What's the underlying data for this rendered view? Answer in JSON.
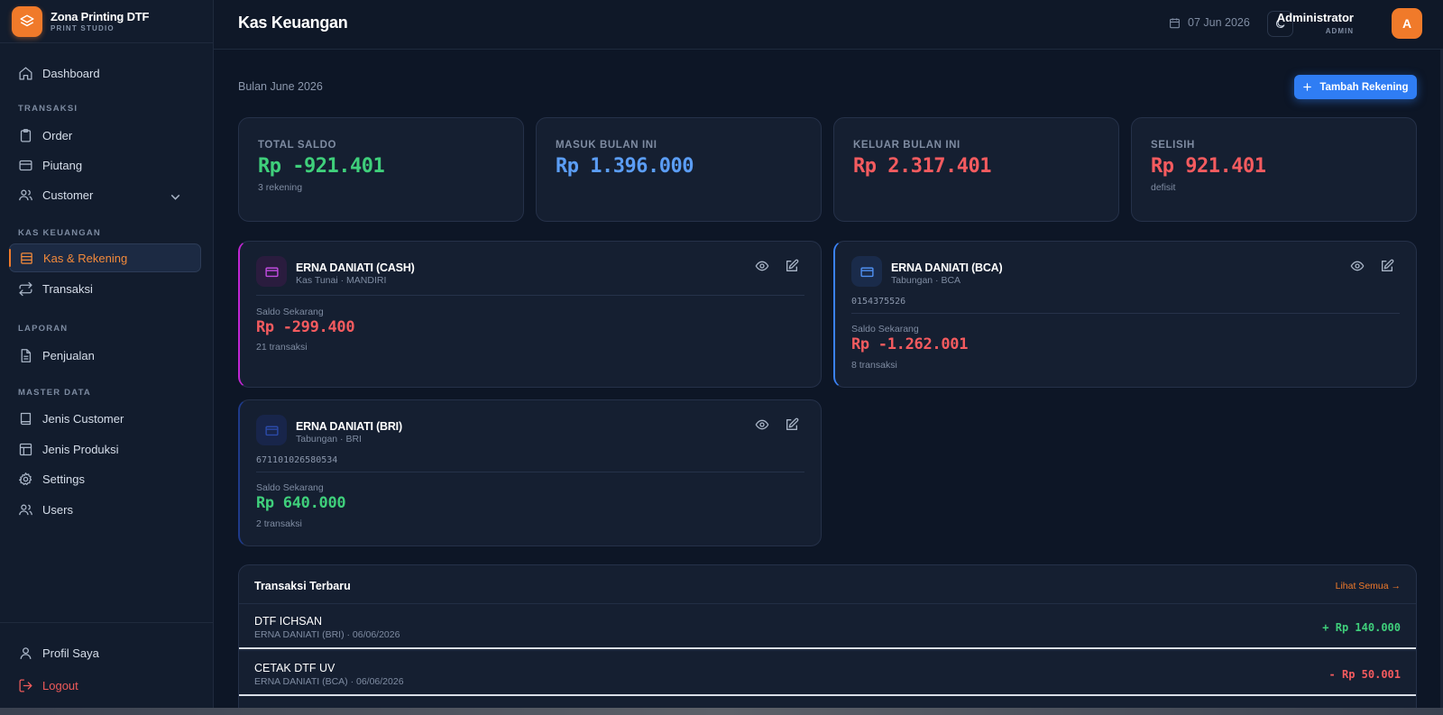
{
  "brand": {
    "name": "Zona Printing DTF",
    "subtitle": "PRINT STUDIO"
  },
  "sidebar": {
    "dashboard": "Dashboard",
    "sections": {
      "transaksi": "TRANSAKSI",
      "kas": "KAS KEUANGAN",
      "laporan": "LAPORAN",
      "master": "MASTER DATA"
    },
    "items": {
      "order": "Order",
      "piutang": "Piutang",
      "customer": "Customer",
      "kas_rekening": "Kas & Rekening",
      "transaksi": "Transaksi",
      "penjualan": "Penjualan",
      "jenis_customer": "Jenis Customer",
      "jenis_produksi": "Jenis Produksi",
      "settings": "Settings",
      "users": "Users"
    },
    "bottom": {
      "profil": "Profil Saya",
      "logout": "Logout"
    }
  },
  "header": {
    "title": "Kas Keuangan",
    "date": "07 Jun 2026",
    "user_name": "Administrator",
    "user_role": "ADMIN",
    "avatar_initial": "A"
  },
  "main": {
    "month_label": "Bulan June 2026",
    "add_button": "Tambah Rekening",
    "stats": [
      {
        "label": "TOTAL SALDO",
        "value": "Rp -921.401",
        "sub": "3 rekening"
      },
      {
        "label": "MASUK BULAN INI",
        "value": "Rp 1.396.000",
        "sub": ""
      },
      {
        "label": "KELUAR BULAN INI",
        "value": "Rp 2.317.401",
        "sub": ""
      },
      {
        "label": "SELISIH",
        "value": "Rp 921.401",
        "sub": "defisit"
      }
    ],
    "accounts": [
      {
        "name": "ERNA DANIATI (CASH)",
        "type": "Kas Tunai · MANDIRI",
        "number": "",
        "balance_label": "Saldo Sekarang",
        "balance": "Rp -299.400",
        "count": "21 transaksi",
        "accent": "#c026d3"
      },
      {
        "name": "ERNA DANIATI (BCA)",
        "type": "Tabungan · BCA",
        "number": "0154375526",
        "balance_label": "Saldo Sekarang",
        "balance": "Rp -1.262.001",
        "count": "8 transaksi",
        "accent": "#3b82f6"
      },
      {
        "name": "ERNA DANIATI (BRI)",
        "type": "Tabungan · BRI",
        "number": "671101026580534",
        "balance_label": "Saldo Sekarang",
        "balance": "Rp 640.000",
        "count": "2 transaksi",
        "accent": "#1e3a8a"
      }
    ],
    "transactions": {
      "title": "Transaksi Terbaru",
      "view_all": "Lihat Semua →",
      "rows": [
        {
          "name": "DTF ICHSAN",
          "meta": "ERNA DANIATI (BRI) · 06/06/2026",
          "amount": "+ Rp 140.000"
        },
        {
          "name": "CETAK DTF UV",
          "meta": "ERNA DANIATI (BCA) · 06/06/2026",
          "amount": "- Rp 50.001"
        }
      ]
    }
  },
  "colors": {
    "accent": "#f07a2a",
    "primary": "#2f7df4",
    "positive": "#3fcf7b",
    "negative": "#f45b5f",
    "info": "#5b9df5"
  }
}
